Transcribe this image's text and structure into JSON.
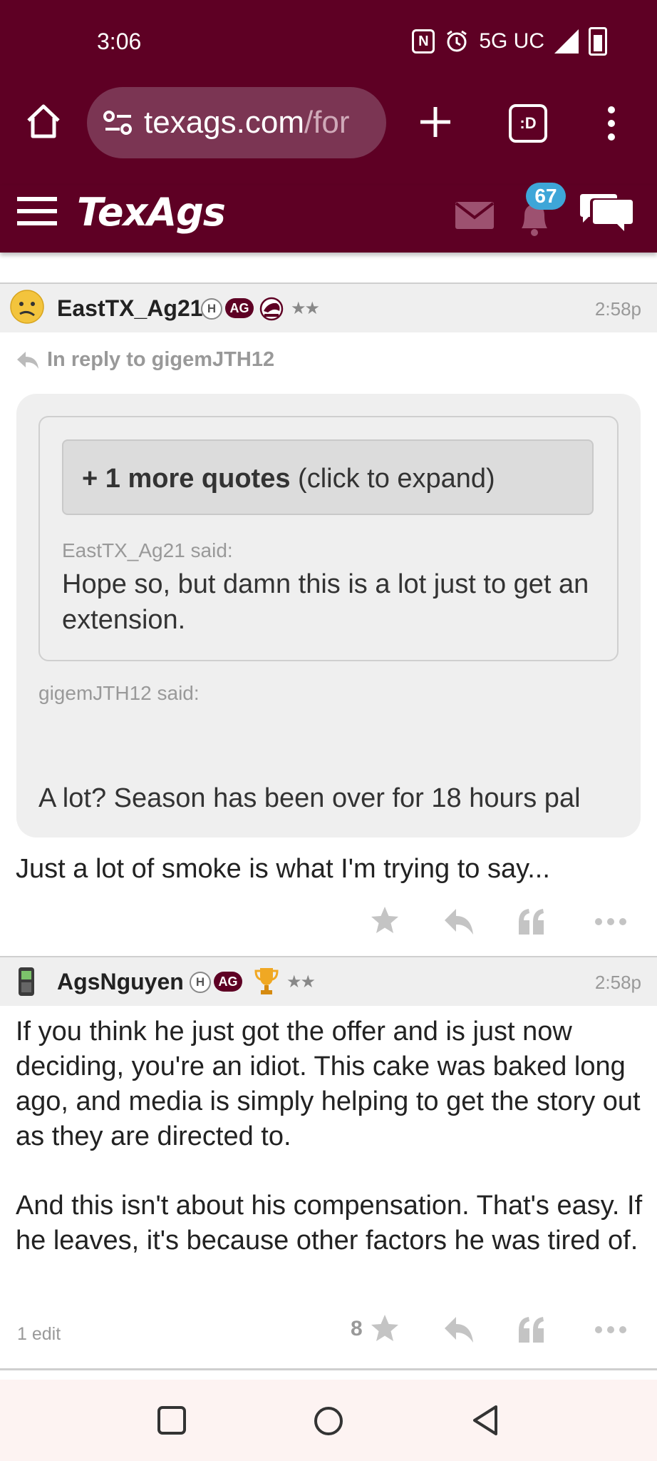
{
  "status_bar": {
    "time": "3:06",
    "network": "5G UC",
    "icons": [
      "nfc-icon",
      "alarm-icon",
      "signal-icon",
      "battery-icon"
    ]
  },
  "browser": {
    "url_host": "texags.com",
    "url_path": "/for",
    "tab_switcher_label": ":D"
  },
  "site": {
    "logo": "TexAgs",
    "notification_count": "67",
    "colors": {
      "maroon": "#5e0024",
      "badge_blue": "#3ea6d8"
    }
  },
  "posts": [
    {
      "username": "EastTX_Ag21",
      "badges": [
        "H",
        "AG"
      ],
      "stars": "★★",
      "time": "2:58p",
      "reply_to": "In reply to gigemJTH12",
      "quote": {
        "expand_bold": "+ 1 more quotes",
        "expand_rest": " (click to expand)",
        "nested_said": "EastTX_Ag21 said:",
        "nested_text": "Hope so, but damn this is a lot just to get an extension.",
        "outer_said": "gigemJTH12 said:",
        "outer_text": "A lot? Season has been over for 18 hours pal"
      },
      "body": "Just a lot of smoke is what I'm trying to say..."
    },
    {
      "username": "AgsNguyen",
      "badges": [
        "H",
        "AG"
      ],
      "stars": "★★",
      "time": "2:58p",
      "body_p1": "If you think he just got the offer and is just now deciding, you're an idiot. This cake was baked long ago, and media is simply helping to get the story out as they are directed to.",
      "body_p2": "And this isn't about his compensation. That's easy. If he leaves, it's because other factors he was tired of.",
      "edit_note": "1 edit",
      "like_count": "8"
    }
  ]
}
